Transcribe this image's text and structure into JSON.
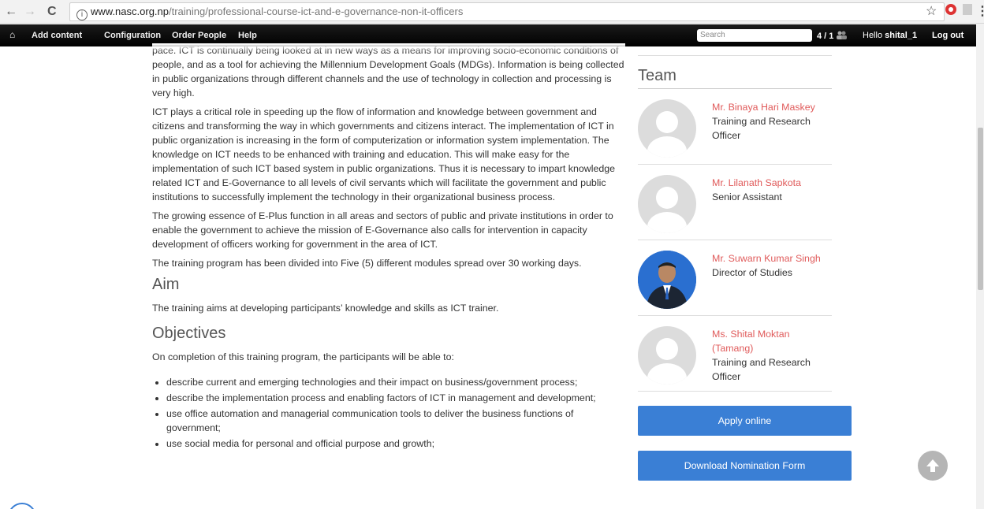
{
  "browser": {
    "back_icon": "←",
    "forward_icon": "→",
    "reload_icon": "C",
    "url_host": "www.nasc.org.np",
    "url_path": "/training/professional-course-ict-and-e-governance-non-it-officers",
    "star_icon": "☆"
  },
  "admin_bar": {
    "home_icon": "⌂",
    "items": [
      "Add content",
      "Configuration",
      "Order People",
      "Help"
    ],
    "search_placeholder": "Search",
    "count": "4 / 1",
    "hello_prefix": "Hello ",
    "username": "shital_1",
    "logout": "Log out"
  },
  "main": {
    "p1": "pace. ICT is continually being looked at in new ways as a means for improving socio-economic conditions of people, and as a tool for achieving the Millennium Development Goals (MDGs). Information is being collected in public organizations through different channels and the use of technology in collection and processing is very high.",
    "p2": "ICT plays a critical role in speeding up the flow of information and knowledge between government and citizens and transforming the way in which governments and citizens interact. The implementation of ICT in public organization is increasing in the form of computerization or information system implementation. The knowledge on ICT needs to be enhanced with training and education. This will make easy for the implementation of such ICT based system in public organizations. Thus it is necessary to impart knowledge related ICT and E-Governance to all levels of civil servants which will facilitate the government and public institutions to successfully implement the technology in their organizational business process.",
    "p3": "The growing essence of E-Plus function in all areas and sectors of public and private institutions in order to enable the government to achieve the mission of E-Governance also calls for intervention in capacity development of officers working for government in the area of ICT.",
    "p4": "The training program has been divided into Five (5) different modules spread over 30 working days.",
    "aim_heading": "Aim",
    "aim_text": "The training aims at developing participants’ knowledge and skills as ICT trainer.",
    "objectives_heading": "Objectives",
    "objectives_intro": "On completion of this training program, the participants will be able to:",
    "objectives": [
      "describe current and emerging technologies and their impact on business/government process;",
      "describe the implementation process and enabling factors of ICT in management and development;",
      "use office automation and managerial communication tools to deliver the business functions of government;",
      "use social media for personal and official purpose and growth;"
    ]
  },
  "team": {
    "title": "Team",
    "members": [
      {
        "name": "Mr. Binaya Hari Maskey",
        "role": "Training and Research Officer"
      },
      {
        "name": "Mr. Lilanath Sapkota",
        "role": "Senior Assistant"
      },
      {
        "name": "Mr. Suwarn Kumar Singh",
        "role": "Director of Studies"
      },
      {
        "name": "Ms. Shital Moktan (Tamang)",
        "role": "Training and Research Officer"
      }
    ]
  },
  "buttons": {
    "apply": "Apply online",
    "download": "Download Nomination Form"
  },
  "colors": {
    "accent": "#3a7fd5",
    "name_link": "#e05b5b"
  }
}
